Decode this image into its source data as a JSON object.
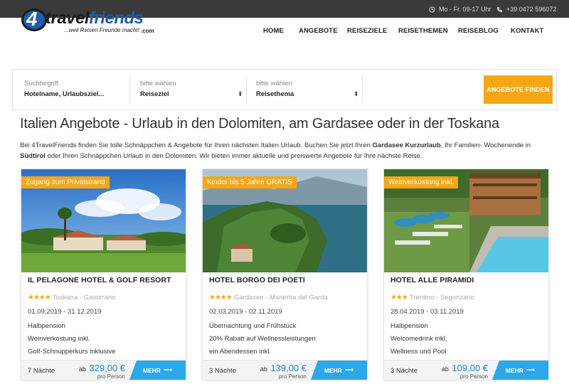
{
  "topbar": {
    "hours": "Mo - Fr. 09-17 Uhr",
    "phone": "+39 0472 596072"
  },
  "logo": {
    "four": "4",
    "word_a": "travel",
    "word_b": "friends",
    "tagline": "...weil Reisen Freunde macht!",
    "domain": ".com"
  },
  "nav": [
    "HOME",
    "ANGEBOTE",
    "REISEZIELE",
    "REISETHEMEN",
    "REISEBLOG",
    "KONTAKT"
  ],
  "search": {
    "field1": {
      "label": "Suchbegriff",
      "value": "Hotelname, Urlaubsziel..."
    },
    "field2": {
      "label": "bitte wählen",
      "value": "Reiseziel"
    },
    "field3": {
      "label": "bitte wählen",
      "value": "Reisethema"
    },
    "button": "ANGEBOTE FINDEN"
  },
  "heading": "Italien Angebote - Urlaub in den Dolomiten, am Gardasee oder in der Toskana",
  "intro": {
    "p1": "Bei 4TravelFriends finden Sie tolle Schnäppchen & Angebote für Ihren nächsten Italien Urlaub. Buchen Sie jetzt Ihren ",
    "b1": "Gardasee Kurzurlaub",
    "p2": ", Ihr Familien- Wochenende in ",
    "b2": "Südtirol",
    "p3": " oder Ihren Schnäppchen Urlaub in den Dolomiten. Wir bieten immer aktuelle und preiswerte Angebote für Ihre nächste Reise."
  },
  "cards": [
    {
      "badge": "Zugang zum Privatstrand",
      "title": "IL PELAGONE HOTEL & GOLF RESORT",
      "stars": "★★★★",
      "location": "Toskana - Gavorrano",
      "dates": "01.09.2019 - 31.12.2019",
      "features": [
        "Halbpension",
        "Weinverkostung inkl.",
        "Golf-Schnupperkurs inklusive"
      ],
      "nights": "7 Nächte",
      "price_prefix": "ab",
      "price": "329,00 €",
      "per_person": "pro Person",
      "more": "MEHR"
    },
    {
      "badge": "Kinder bis 5 Jahre GRATIS",
      "title": "HOTEL BORGO DEI POETI",
      "stars": "★★★★",
      "location": "Gardasee - Manerba del Garda",
      "dates": "02.03.2019 - 02.11.2019",
      "features": [
        "Übernachtung und Frühstück",
        "20% Rabatt auf Wellnessleistungen",
        "ein Abendessen inkl."
      ],
      "nights": "3 Nächte",
      "price_prefix": "ab",
      "price": "139,00 €",
      "per_person": "pro Person",
      "more": "MEHR"
    },
    {
      "badge": "Weinverkostung inkl.",
      "title": "HOTEL ALLE PIRAMIDI",
      "stars": "★★★",
      "location": "Trentino - Segonzano",
      "dates": "28.04.2019 - 03.11.2019",
      "features": [
        "Halbpension",
        "Welcomedrink inkl.",
        "Wellness und Pool"
      ],
      "nights": "3 Nächte",
      "price_prefix": "ab",
      "price": "109,00 €",
      "per_person": "pro Person",
      "more": "MEHR"
    }
  ],
  "colors": {
    "accent": "#f5a716",
    "button_blue": "#2aa8e8",
    "price_blue": "#1f88d6",
    "topbar": "#3a3a3a"
  }
}
